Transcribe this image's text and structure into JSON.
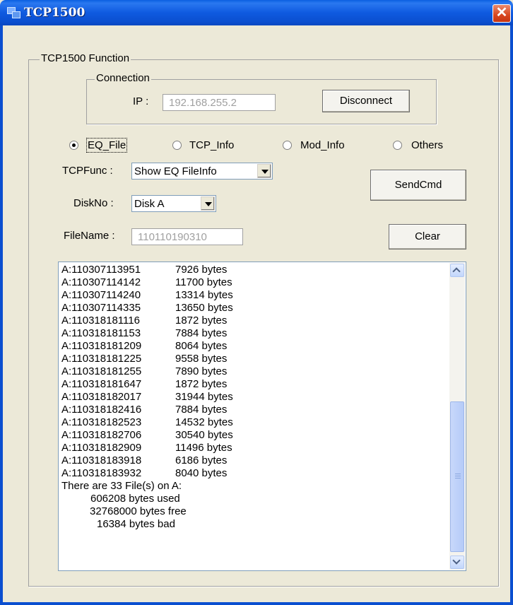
{
  "window": {
    "title": "TCP1500",
    "close_glyph": "✕",
    "icon": "network-icon"
  },
  "function_group": {
    "legend": "TCP1500 Function"
  },
  "connection": {
    "legend": "Connection",
    "ip_label": "IP :",
    "ip_value": "192.168.255.2",
    "disconnect_label": "Disconnect"
  },
  "mode_options": [
    {
      "label": "EQ_File",
      "checked": true
    },
    {
      "label": "TCP_Info",
      "checked": false
    },
    {
      "label": "Mod_Info",
      "checked": false
    },
    {
      "label": "Others",
      "checked": false
    }
  ],
  "tcpfunc": {
    "label": "TCPFunc :",
    "value": "Show EQ FileInfo"
  },
  "diskno": {
    "label": "DiskNo :",
    "value": "Disk A"
  },
  "filename": {
    "label": "FileName :",
    "value": "110110190310"
  },
  "sendcmd_label": "SendCmd",
  "clear_label": "Clear",
  "output": {
    "files": [
      {
        "name": "A:110307113951",
        "size": "7926 bytes"
      },
      {
        "name": "A:110307114142",
        "size": "11700 bytes"
      },
      {
        "name": "A:110307114240",
        "size": "13314 bytes"
      },
      {
        "name": "A:110307114335",
        "size": "13650 bytes"
      },
      {
        "name": "A:110318181116",
        "size": "1872 bytes"
      },
      {
        "name": "A:110318181153",
        "size": "7884 bytes"
      },
      {
        "name": "A:110318181209",
        "size": "8064 bytes"
      },
      {
        "name": "A:110318181225",
        "size": "9558 bytes"
      },
      {
        "name": "A:110318181255",
        "size": "7890 bytes"
      },
      {
        "name": "A:110318181647",
        "size": "1872 bytes"
      },
      {
        "name": "A:110318182017",
        "size": "31944 bytes"
      },
      {
        "name": "A:110318182416",
        "size": "7884 bytes"
      },
      {
        "name": "A:110318182523",
        "size": "14532 bytes"
      },
      {
        "name": "A:110318182706",
        "size": "30540 bytes"
      },
      {
        "name": "A:110318182909",
        "size": "11496 bytes"
      },
      {
        "name": "A:110318183918",
        "size": "6186 bytes"
      },
      {
        "name": "A:110318183932",
        "size": "8040 bytes"
      }
    ],
    "summary": [
      "There are 33 File(s) on A:",
      "606208 bytes used",
      "32768000 bytes free",
      "16384 bytes bad"
    ]
  }
}
